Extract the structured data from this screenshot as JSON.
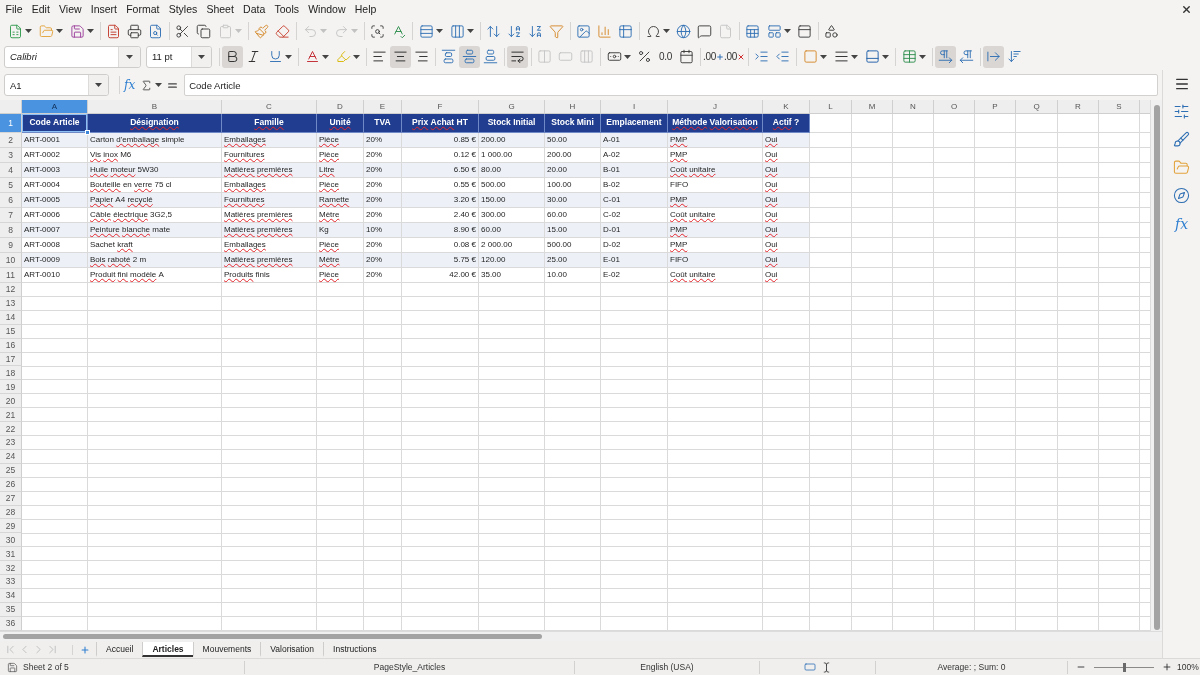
{
  "menu_bar": {
    "items": [
      "File",
      "Edit",
      "View",
      "Insert",
      "Format",
      "Styles",
      "Sheet",
      "Data",
      "Tools",
      "Window",
      "Help"
    ]
  },
  "standard_toolbar": {
    "groups": [
      [
        {
          "kind": "new",
          "dropdown": true,
          "disabled": false
        },
        {
          "kind": "open",
          "dropdown": true,
          "disabled": false
        },
        {
          "kind": "save",
          "dropdown": true,
          "disabled": false
        }
      ],
      [
        {
          "kind": "export_pdf",
          "dropdown": false,
          "disabled": false
        },
        {
          "kind": "print",
          "dropdown": false,
          "disabled": false
        },
        {
          "kind": "print_preview",
          "dropdown": false,
          "disabled": false
        }
      ],
      [
        {
          "kind": "cut",
          "dropdown": false,
          "disabled": false
        },
        {
          "kind": "copy",
          "dropdown": false,
          "disabled": false
        },
        {
          "kind": "paste",
          "dropdown": true,
          "disabled": true
        }
      ],
      [
        {
          "kind": "clone_formatting",
          "dropdown": false,
          "disabled": false
        },
        {
          "kind": "clear_formatting",
          "dropdown": false,
          "disabled": false
        }
      ],
      [
        {
          "kind": "undo",
          "dropdown": true,
          "disabled": true
        },
        {
          "kind": "redo",
          "dropdown": true,
          "disabled": true
        }
      ],
      [
        {
          "kind": "find_replace",
          "dropdown": false,
          "disabled": false
        },
        {
          "kind": "spelling",
          "dropdown": false,
          "disabled": false
        }
      ],
      [
        {
          "kind": "row",
          "dropdown": true,
          "disabled": false
        },
        {
          "kind": "column",
          "dropdown": true,
          "disabled": false
        }
      ],
      [
        {
          "kind": "sort",
          "dropdown": false,
          "disabled": false
        },
        {
          "kind": "sort_ascending",
          "dropdown": false,
          "disabled": false
        },
        {
          "kind": "sort_descending",
          "dropdown": false,
          "disabled": false
        },
        {
          "kind": "autofilter",
          "dropdown": false,
          "disabled": false
        }
      ],
      [
        {
          "kind": "image",
          "dropdown": false,
          "disabled": false
        },
        {
          "kind": "chart",
          "dropdown": false,
          "disabled": false
        },
        {
          "kind": "pivot_table",
          "dropdown": false,
          "disabled": false
        }
      ],
      [
        {
          "kind": "special_character",
          "dropdown": true,
          "disabled": false
        },
        {
          "kind": "hyperlink",
          "dropdown": false,
          "disabled": false
        },
        {
          "kind": "comment",
          "dropdown": false,
          "disabled": false
        },
        {
          "kind": "headers_footers",
          "dropdown": false,
          "disabled": true
        }
      ],
      [
        {
          "kind": "print_area",
          "dropdown": false,
          "disabled": false
        },
        {
          "kind": "freeze",
          "dropdown": true,
          "disabled": false
        },
        {
          "kind": "split_window",
          "dropdown": false,
          "disabled": false
        }
      ],
      [
        {
          "kind": "shapes",
          "dropdown": false,
          "disabled": false
        }
      ]
    ]
  },
  "formatting_toolbar": {
    "font_name": "Calibri",
    "font_size": "11 pt",
    "groups": [
      [
        {
          "kind": "bold",
          "dropdown": false,
          "pressed": true,
          "disabled": false
        },
        {
          "kind": "italic",
          "dropdown": false,
          "pressed": false,
          "disabled": false
        },
        {
          "kind": "underline",
          "dropdown": true,
          "pressed": false,
          "disabled": false
        }
      ],
      [
        {
          "kind": "font_color",
          "dropdown": true,
          "pressed": false,
          "disabled": false
        },
        {
          "kind": "highlighting",
          "dropdown": true,
          "pressed": false,
          "disabled": false
        }
      ],
      [
        {
          "kind": "align_left",
          "dropdown": false,
          "pressed": false,
          "disabled": false
        },
        {
          "kind": "align_center",
          "dropdown": false,
          "pressed": true,
          "disabled": false
        },
        {
          "kind": "align_right",
          "dropdown": false,
          "pressed": false,
          "disabled": false
        }
      ],
      [
        {
          "kind": "align_top",
          "dropdown": false,
          "pressed": false,
          "disabled": false
        },
        {
          "kind": "align_middle",
          "dropdown": false,
          "pressed": true,
          "disabled": false
        },
        {
          "kind": "align_bottom",
          "dropdown": false,
          "pressed": false,
          "disabled": false
        }
      ],
      [
        {
          "kind": "wrap_text",
          "dropdown": false,
          "pressed": true,
          "disabled": false
        }
      ],
      [
        {
          "kind": "merge_center",
          "dropdown": false,
          "pressed": false,
          "disabled": true
        },
        {
          "kind": "merge",
          "dropdown": false,
          "pressed": false,
          "disabled": true
        },
        {
          "kind": "unmerge",
          "dropdown": false,
          "pressed": false,
          "disabled": true
        }
      ],
      [
        {
          "kind": "currency",
          "dropdown": true,
          "pressed": false,
          "disabled": false
        },
        {
          "kind": "percent",
          "dropdown": false,
          "pressed": false,
          "disabled": false
        },
        {
          "kind": "number_format",
          "glyph": "0.0",
          "dropdown": false,
          "pressed": false,
          "disabled": false
        },
        {
          "kind": "date",
          "dropdown": false,
          "pressed": false,
          "disabled": false
        }
      ],
      [
        {
          "kind": "add_decimal",
          "glyph": ".00",
          "dropdown": false,
          "pressed": false,
          "disabled": false
        },
        {
          "kind": "delete_decimal",
          "glyph": ".00",
          "dropdown": false,
          "pressed": false,
          "disabled": false
        }
      ],
      [
        {
          "kind": "indent_increase",
          "dropdown": false,
          "pressed": false,
          "disabled": false
        },
        {
          "kind": "indent_decrease",
          "dropdown": false,
          "pressed": false,
          "disabled": false
        }
      ],
      [
        {
          "kind": "borders",
          "dropdown": true,
          "pressed": false,
          "disabled": false
        },
        {
          "kind": "border_style",
          "dropdown": true,
          "pressed": false,
          "disabled": false
        },
        {
          "kind": "border_color",
          "dropdown": true,
          "pressed": false,
          "disabled": false
        }
      ],
      [
        {
          "kind": "conditional",
          "dropdown": true,
          "pressed": false,
          "disabled": false
        }
      ],
      [
        {
          "kind": "left_to_right",
          "dropdown": false,
          "pressed": true,
          "disabled": false
        },
        {
          "kind": "right_to_left",
          "dropdown": false,
          "pressed": false,
          "disabled": false
        }
      ],
      [
        {
          "kind": "text_direction",
          "dropdown": false,
          "pressed": true,
          "disabled": false
        },
        {
          "kind": "vertical_text",
          "dropdown": false,
          "pressed": false,
          "disabled": false
        }
      ]
    ]
  },
  "formula_bar": {
    "name_box": "A1",
    "function_glyph": "fx",
    "content": "Code Article"
  },
  "sheet": {
    "columns": [
      {
        "label": "A",
        "selected": true
      },
      {
        "label": "B",
        "selected": false
      },
      {
        "label": "C",
        "selected": false
      },
      {
        "label": "D",
        "selected": false
      },
      {
        "label": "E",
        "selected": false
      },
      {
        "label": "F",
        "selected": false
      },
      {
        "label": "G",
        "selected": false
      },
      {
        "label": "H",
        "selected": false
      },
      {
        "label": "I",
        "selected": false
      },
      {
        "label": "J",
        "selected": false
      },
      {
        "label": "K",
        "selected": false
      },
      {
        "label": "L",
        "selected": false
      },
      {
        "label": "M",
        "selected": false
      },
      {
        "label": "N",
        "selected": false
      },
      {
        "label": "O",
        "selected": false
      },
      {
        "label": "P",
        "selected": false
      },
      {
        "label": "Q",
        "selected": false
      },
      {
        "label": "R",
        "selected": false
      },
      {
        "label": "S",
        "selected": false
      }
    ],
    "rows": [
      {
        "number": "1",
        "selected": true,
        "kind": "header",
        "cells": [
          {
            "text": "Code Article",
            "misspelled": [
              false,
              false
            ]
          },
          {
            "text": "Désignation",
            "misspelled": [
              true
            ]
          },
          {
            "text": "Famille",
            "misspelled": [
              true
            ]
          },
          {
            "text": "Unité",
            "misspelled": [
              true
            ]
          },
          {
            "text": "TVA",
            "misspelled": [
              false
            ]
          },
          {
            "text": "Prix Achat HT",
            "misspelled": [
              true,
              true,
              false
            ]
          },
          {
            "text": "Stock Initial",
            "misspelled": [
              false,
              false
            ]
          },
          {
            "text": "Stock Mini",
            "misspelled": [
              false,
              false
            ]
          },
          {
            "text": "Emplacement",
            "misspelled": [
              false
            ]
          },
          {
            "text": "Méthode Valorisation",
            "misspelled": [
              true,
              true
            ]
          },
          {
            "text": "Actif ?",
            "misspelled": [
              true,
              false
            ]
          }
        ]
      },
      {
        "number": "2",
        "selected": false,
        "kind": "data",
        "cells": [
          {
            "text": "ART-0001",
            "misspelled": [
              false
            ]
          },
          {
            "text": "Carton d'emballage simple",
            "misspelled": [
              false,
              true,
              false
            ]
          },
          {
            "text": "Emballages",
            "misspelled": [
              true
            ]
          },
          {
            "text": "Pièce",
            "misspelled": [
              true
            ]
          },
          {
            "text": "20%",
            "misspelled": [
              false
            ]
          },
          {
            "text": "0.85 €",
            "misspelled": [
              false,
              false
            ]
          },
          {
            "text": "200.00",
            "misspelled": [
              false
            ]
          },
          {
            "text": "50.00",
            "misspelled": [
              false
            ]
          },
          {
            "text": "A-01",
            "misspelled": [
              false
            ]
          },
          {
            "text": "PMP",
            "misspelled": [
              true
            ]
          },
          {
            "text": "Oui",
            "misspelled": [
              true
            ]
          }
        ]
      },
      {
        "number": "3",
        "selected": false,
        "kind": "data",
        "cells": [
          {
            "text": "ART-0002",
            "misspelled": [
              false
            ]
          },
          {
            "text": "Vis inox M6",
            "misspelled": [
              true,
              true,
              false
            ]
          },
          {
            "text": "Fournitures",
            "misspelled": [
              true
            ]
          },
          {
            "text": "Pièce",
            "misspelled": [
              true
            ]
          },
          {
            "text": "20%",
            "misspelled": [
              false
            ]
          },
          {
            "text": "0.12 €",
            "misspelled": [
              false,
              false
            ]
          },
          {
            "text": "1 000.00",
            "misspelled": [
              false,
              false
            ]
          },
          {
            "text": "200.00",
            "misspelled": [
              false
            ]
          },
          {
            "text": "A-02",
            "misspelled": [
              false
            ]
          },
          {
            "text": "PMP",
            "misspelled": [
              true
            ]
          },
          {
            "text": "Oui",
            "misspelled": [
              true
            ]
          }
        ]
      },
      {
        "number": "4",
        "selected": false,
        "kind": "data",
        "cells": [
          {
            "text": "ART-0003",
            "misspelled": [
              false
            ]
          },
          {
            "text": "Huile moteur 5W30",
            "misspelled": [
              true,
              true,
              false
            ]
          },
          {
            "text": "Matières premières",
            "misspelled": [
              true,
              true
            ]
          },
          {
            "text": "Litre",
            "misspelled": [
              true
            ]
          },
          {
            "text": "20%",
            "misspelled": [
              false
            ]
          },
          {
            "text": "6.50 €",
            "misspelled": [
              false,
              false
            ]
          },
          {
            "text": "80.00",
            "misspelled": [
              false
            ]
          },
          {
            "text": "20.00",
            "misspelled": [
              false
            ]
          },
          {
            "text": "B-01",
            "misspelled": [
              false
            ]
          },
          {
            "text": "Coût unitaire",
            "misspelled": [
              true,
              true
            ]
          },
          {
            "text": "Oui",
            "misspelled": [
              true
            ]
          }
        ]
      },
      {
        "number": "5",
        "selected": false,
        "kind": "data",
        "cells": [
          {
            "text": "ART-0004",
            "misspelled": [
              false
            ]
          },
          {
            "text": "Bouteille en verre 75 cl",
            "misspelled": [
              true,
              false,
              true,
              false,
              false
            ]
          },
          {
            "text": "Emballages",
            "misspelled": [
              true
            ]
          },
          {
            "text": "Pièce",
            "misspelled": [
              true
            ]
          },
          {
            "text": "20%",
            "misspelled": [
              false
            ]
          },
          {
            "text": "0.55 €",
            "misspelled": [
              false,
              false
            ]
          },
          {
            "text": "500.00",
            "misspelled": [
              false
            ]
          },
          {
            "text": "100.00",
            "misspelled": [
              false
            ]
          },
          {
            "text": "B-02",
            "misspelled": [
              false
            ]
          },
          {
            "text": "FIFO",
            "misspelled": [
              false
            ]
          },
          {
            "text": "Oui",
            "misspelled": [
              true
            ]
          }
        ]
      },
      {
        "number": "6",
        "selected": false,
        "kind": "data",
        "cells": [
          {
            "text": "ART-0005",
            "misspelled": [
              false
            ]
          },
          {
            "text": "Papier A4 recyclé",
            "misspelled": [
              true,
              false,
              true
            ]
          },
          {
            "text": "Fournitures",
            "misspelled": [
              true
            ]
          },
          {
            "text": "Ramette",
            "misspelled": [
              true
            ]
          },
          {
            "text": "20%",
            "misspelled": [
              false
            ]
          },
          {
            "text": "3.20 €",
            "misspelled": [
              false,
              false
            ]
          },
          {
            "text": "150.00",
            "misspelled": [
              false
            ]
          },
          {
            "text": "30.00",
            "misspelled": [
              false
            ]
          },
          {
            "text": "C-01",
            "misspelled": [
              false
            ]
          },
          {
            "text": "PMP",
            "misspelled": [
              true
            ]
          },
          {
            "text": "Oui",
            "misspelled": [
              true
            ]
          }
        ]
      },
      {
        "number": "7",
        "selected": false,
        "kind": "data",
        "cells": [
          {
            "text": "ART-0006",
            "misspelled": [
              false
            ]
          },
          {
            "text": "Câble électrique 3G2,5",
            "misspelled": [
              true,
              true,
              false
            ]
          },
          {
            "text": "Matières premières",
            "misspelled": [
              true,
              true
            ]
          },
          {
            "text": "Mètre",
            "misspelled": [
              true
            ]
          },
          {
            "text": "20%",
            "misspelled": [
              false
            ]
          },
          {
            "text": "2.40 €",
            "misspelled": [
              false,
              false
            ]
          },
          {
            "text": "300.00",
            "misspelled": [
              false
            ]
          },
          {
            "text": "60.00",
            "misspelled": [
              false
            ]
          },
          {
            "text": "C-02",
            "misspelled": [
              false
            ]
          },
          {
            "text": "Coût unitaire",
            "misspelled": [
              true,
              true
            ]
          },
          {
            "text": "Oui",
            "misspelled": [
              true
            ]
          }
        ]
      },
      {
        "number": "8",
        "selected": false,
        "kind": "data",
        "cells": [
          {
            "text": "ART-0007",
            "misspelled": [
              false
            ]
          },
          {
            "text": "Peinture blanche mate",
            "misspelled": [
              true,
              true,
              false
            ]
          },
          {
            "text": "Matières premières",
            "misspelled": [
              true,
              true
            ]
          },
          {
            "text": "Kg",
            "misspelled": [
              false
            ]
          },
          {
            "text": "10%",
            "misspelled": [
              false
            ]
          },
          {
            "text": "8.90 €",
            "misspelled": [
              false,
              false
            ]
          },
          {
            "text": "60.00",
            "misspelled": [
              false
            ]
          },
          {
            "text": "15.00",
            "misspelled": [
              false
            ]
          },
          {
            "text": "D-01",
            "misspelled": [
              false
            ]
          },
          {
            "text": "PMP",
            "misspelled": [
              true
            ]
          },
          {
            "text": "Oui",
            "misspelled": [
              true
            ]
          }
        ]
      },
      {
        "number": "9",
        "selected": false,
        "kind": "data",
        "cells": [
          {
            "text": "ART-0008",
            "misspelled": [
              false
            ]
          },
          {
            "text": "Sachet kraft",
            "misspelled": [
              false,
              true
            ]
          },
          {
            "text": "Emballages",
            "misspelled": [
              true
            ]
          },
          {
            "text": "Pièce",
            "misspelled": [
              true
            ]
          },
          {
            "text": "20%",
            "misspelled": [
              false
            ]
          },
          {
            "text": "0.08 €",
            "misspelled": [
              false,
              false
            ]
          },
          {
            "text": "2 000.00",
            "misspelled": [
              false,
              false
            ]
          },
          {
            "text": "500.00",
            "misspelled": [
              false
            ]
          },
          {
            "text": "D-02",
            "misspelled": [
              false
            ]
          },
          {
            "text": "PMP",
            "misspelled": [
              true
            ]
          },
          {
            "text": "Oui",
            "misspelled": [
              true
            ]
          }
        ]
      },
      {
        "number": "10",
        "selected": false,
        "kind": "data",
        "cells": [
          {
            "text": "ART-0009",
            "misspelled": [
              false
            ]
          },
          {
            "text": "Bois raboté 2 m",
            "misspelled": [
              true,
              true,
              false,
              false
            ]
          },
          {
            "text": "Matières premières",
            "misspelled": [
              true,
              true
            ]
          },
          {
            "text": "Mètre",
            "misspelled": [
              true
            ]
          },
          {
            "text": "20%",
            "misspelled": [
              false
            ]
          },
          {
            "text": "5.75 €",
            "misspelled": [
              false,
              false
            ]
          },
          {
            "text": "120.00",
            "misspelled": [
              false
            ]
          },
          {
            "text": "25.00",
            "misspelled": [
              false
            ]
          },
          {
            "text": "E-01",
            "misspelled": [
              false
            ]
          },
          {
            "text": "FIFO",
            "misspelled": [
              false
            ]
          },
          {
            "text": "Oui",
            "misspelled": [
              true
            ]
          }
        ]
      },
      {
        "number": "11",
        "selected": false,
        "kind": "data",
        "cells": [
          {
            "text": "ART-0010",
            "misspelled": [
              false
            ]
          },
          {
            "text": "Produit fini modèle A",
            "misspelled": [
              true,
              true,
              true,
              false
            ]
          },
          {
            "text": "Produits finis",
            "misspelled": [
              true,
              false
            ]
          },
          {
            "text": "Pièce",
            "misspelled": [
              true
            ]
          },
          {
            "text": "20%",
            "misspelled": [
              false
            ]
          },
          {
            "text": "42.00 €",
            "misspelled": [
              false,
              false
            ]
          },
          {
            "text": "35.00",
            "misspelled": [
              false
            ]
          },
          {
            "text": "10.00",
            "misspelled": [
              false
            ]
          },
          {
            "text": "E-02",
            "misspelled": [
              false
            ]
          },
          {
            "text": "Coût unitaire",
            "misspelled": [
              true,
              true
            ]
          },
          {
            "text": "Oui",
            "misspelled": [
              true
            ]
          }
        ]
      },
      {
        "number": "12",
        "selected": false,
        "kind": "empty"
      },
      {
        "number": "13",
        "selected": false,
        "kind": "empty"
      },
      {
        "number": "14",
        "selected": false,
        "kind": "empty"
      },
      {
        "number": "15",
        "selected": false,
        "kind": "empty"
      },
      {
        "number": "16",
        "selected": false,
        "kind": "empty"
      },
      {
        "number": "17",
        "selected": false,
        "kind": "empty"
      },
      {
        "number": "18",
        "selected": false,
        "kind": "empty"
      },
      {
        "number": "19",
        "selected": false,
        "kind": "empty"
      },
      {
        "number": "20",
        "selected": false,
        "kind": "empty"
      },
      {
        "number": "21",
        "selected": false,
        "kind": "empty"
      },
      {
        "number": "22",
        "selected": false,
        "kind": "empty"
      },
      {
        "number": "23",
        "selected": false,
        "kind": "empty"
      },
      {
        "number": "24",
        "selected": false,
        "kind": "empty"
      },
      {
        "number": "25",
        "selected": false,
        "kind": "empty"
      },
      {
        "number": "26",
        "selected": false,
        "kind": "empty"
      },
      {
        "number": "27",
        "selected": false,
        "kind": "empty"
      },
      {
        "number": "28",
        "selected": false,
        "kind": "empty"
      },
      {
        "number": "29",
        "selected": false,
        "kind": "empty"
      },
      {
        "number": "30",
        "selected": false,
        "kind": "empty"
      },
      {
        "number": "31",
        "selected": false,
        "kind": "empty"
      },
      {
        "number": "32",
        "selected": false,
        "kind": "empty"
      },
      {
        "number": "33",
        "selected": false,
        "kind": "empty"
      },
      {
        "number": "34",
        "selected": false,
        "kind": "empty"
      },
      {
        "number": "35",
        "selected": false,
        "kind": "empty"
      },
      {
        "number": "36",
        "selected": false,
        "kind": "empty"
      }
    ]
  },
  "sheet_tabs": [
    {
      "label": "Accueil",
      "selected": false
    },
    {
      "label": "Articles",
      "selected": true
    },
    {
      "label": "Mouvements",
      "selected": false
    },
    {
      "label": "Valorisation",
      "selected": false
    },
    {
      "label": "Instructions",
      "selected": false
    }
  ],
  "sidebar": {
    "function_glyph": "fx"
  },
  "status_bar": {
    "sheet_position": "Sheet 2 of 5",
    "page_style": "PageStyle_Articles",
    "language": "English (USA)",
    "summary": "Average: ; Sum: 0",
    "zoom": {
      "label": "100%",
      "level": 0.5
    }
  }
}
